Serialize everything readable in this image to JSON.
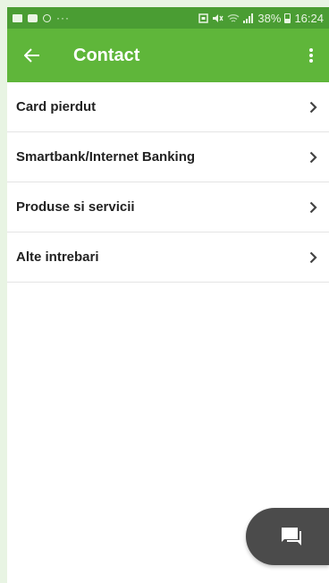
{
  "status_bar": {
    "left_icons": [
      "gallery-icon",
      "message-icon",
      "status-circle-icon",
      "more-dots-icon"
    ],
    "dots": "···",
    "right_icons": [
      "sim-icon",
      "mute-icon",
      "wifi-icon",
      "signal-icon"
    ],
    "battery": "38%",
    "time": "16:24"
  },
  "app_bar": {
    "back_icon": "arrow-left-icon",
    "title": "Contact",
    "menu_icon": "more-vertical-icon"
  },
  "list": {
    "items": [
      {
        "label": "Card pierdut"
      },
      {
        "label": "Smartbank/Internet Banking"
      },
      {
        "label": "Produse si servicii"
      },
      {
        "label": "Alte intrebari"
      }
    ]
  },
  "fab": {
    "icon": "chat-icon"
  },
  "colors": {
    "status_bar": "#4a9d33",
    "app_bar": "#5fb63a",
    "background": "#e8f4e3",
    "fab": "#4b4b4b"
  }
}
